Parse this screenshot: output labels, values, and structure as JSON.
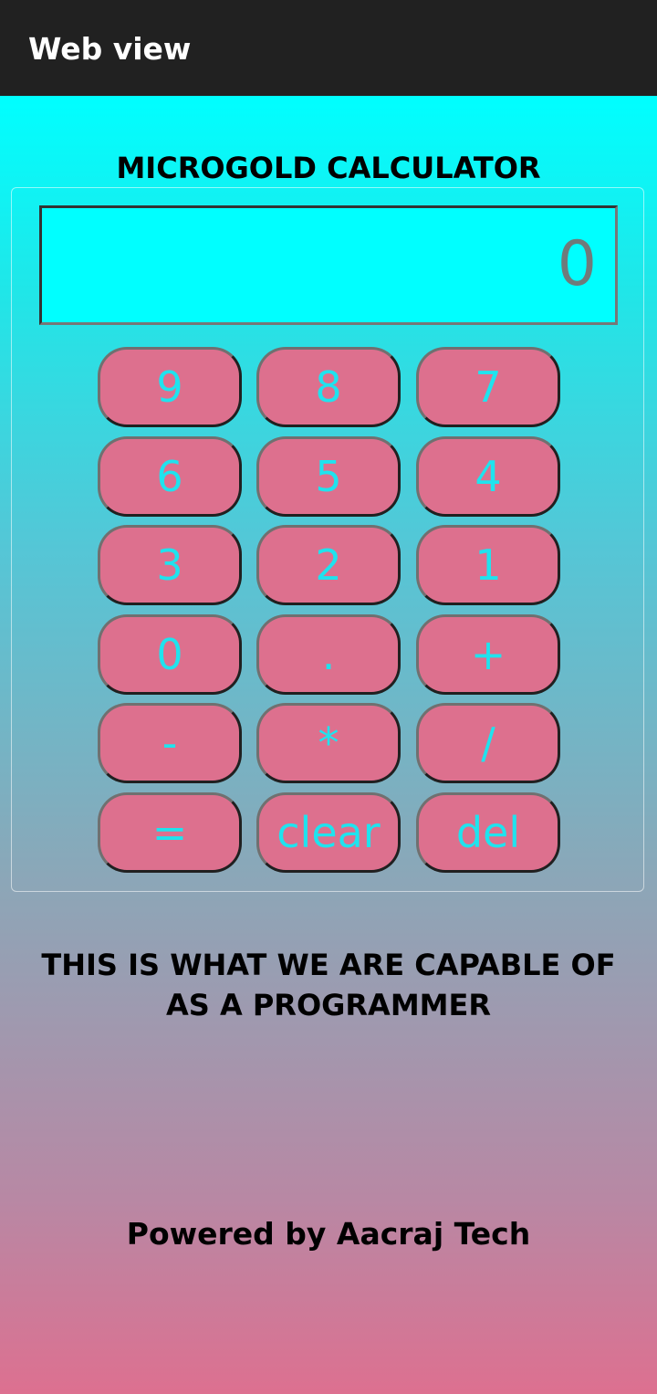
{
  "appbar": {
    "title": "Web view"
  },
  "calculator": {
    "title": "MICROGOLD CALCULATOR",
    "display_value": "0",
    "keys": [
      "9",
      "8",
      "7",
      "6",
      "5",
      "4",
      "3",
      "2",
      "1",
      "0",
      ".",
      "+",
      "-",
      "*",
      "/",
      "=",
      "clear",
      "del"
    ]
  },
  "tagline": "THIS IS WHAT WE ARE CAPABLE OF AS A PROGRAMMER",
  "footer": "Powered by Aacraj Tech",
  "colors": {
    "appbar_bg": "#212121",
    "gradient_top": "#00ffff",
    "gradient_bottom": "#dd7090",
    "key_bg": "#dd708e",
    "key_text": "#1fe3ee",
    "display_bg": "#00ffff",
    "display_text": "#6f7b7b"
  }
}
